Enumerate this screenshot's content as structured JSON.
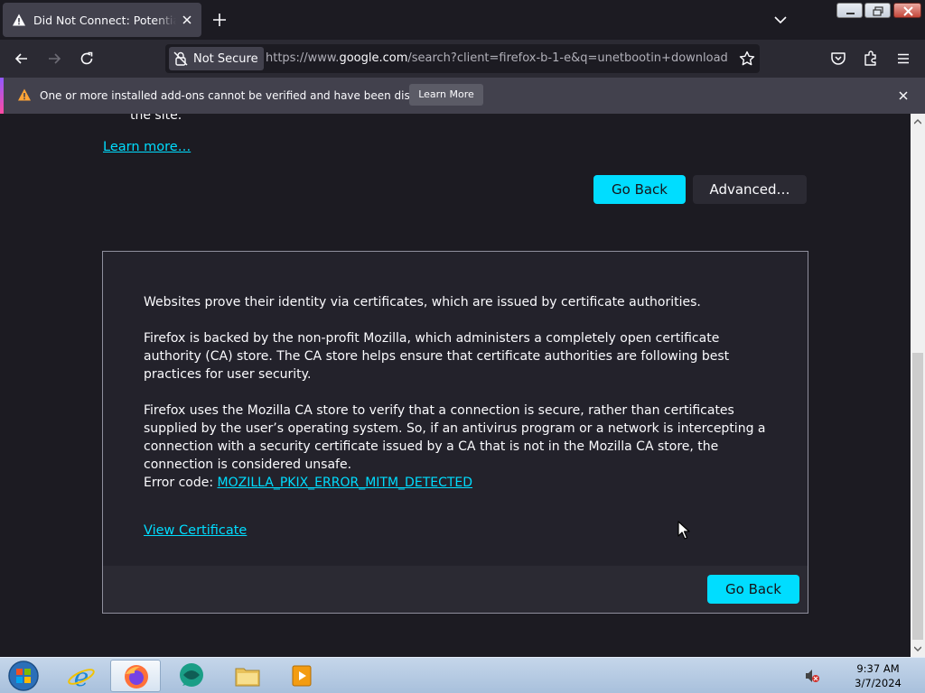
{
  "tab": {
    "title": "Did Not Connect: Potential Security Issue"
  },
  "navbar": {
    "security_label": "Not Secure",
    "url_prefix": "https://www.",
    "url_domain": "google.com",
    "url_rest": "/search?client=firefox-b-1-e&q=unetbootin+download"
  },
  "notification": {
    "message": "One or more installed add-ons cannot be verified and have been disabled.",
    "button_label": "Learn More"
  },
  "page": {
    "snippet_text": "the site.",
    "learn_more_link": "Learn more…",
    "go_back_label": "Go Back",
    "advanced_label": "Advanced…",
    "panel": {
      "para1": "Websites prove their identity via certificates, which are issued by certificate authorities.",
      "para2": "Firefox is backed by the non-profit Mozilla, which administers a completely open certificate authority (CA) store. The CA store helps ensure that certificate authorities are following best practices for user security.",
      "para3": "Firefox uses the Mozilla CA store to verify that a connection is secure, rather than certificates supplied by the user’s operating system. So, if an antivirus program or a network is intercepting a connection with a security certificate issued by a CA that is not in the Mozilla CA store, the connection is considered unsafe.",
      "error_code_label": "Error code: ",
      "error_code": "MOZILLA_PKIX_ERROR_MITM_DETECTED",
      "view_certificate": "View Certificate",
      "go_back_label": "Go Back"
    }
  },
  "taskbar": {
    "time": "9:37 AM",
    "date": "3/7/2024"
  },
  "colors": {
    "accent": "#00ddff",
    "page_bg": "#1c1b22",
    "panel_bg": "#23222b",
    "toolbar_bg": "#2b2a33"
  }
}
